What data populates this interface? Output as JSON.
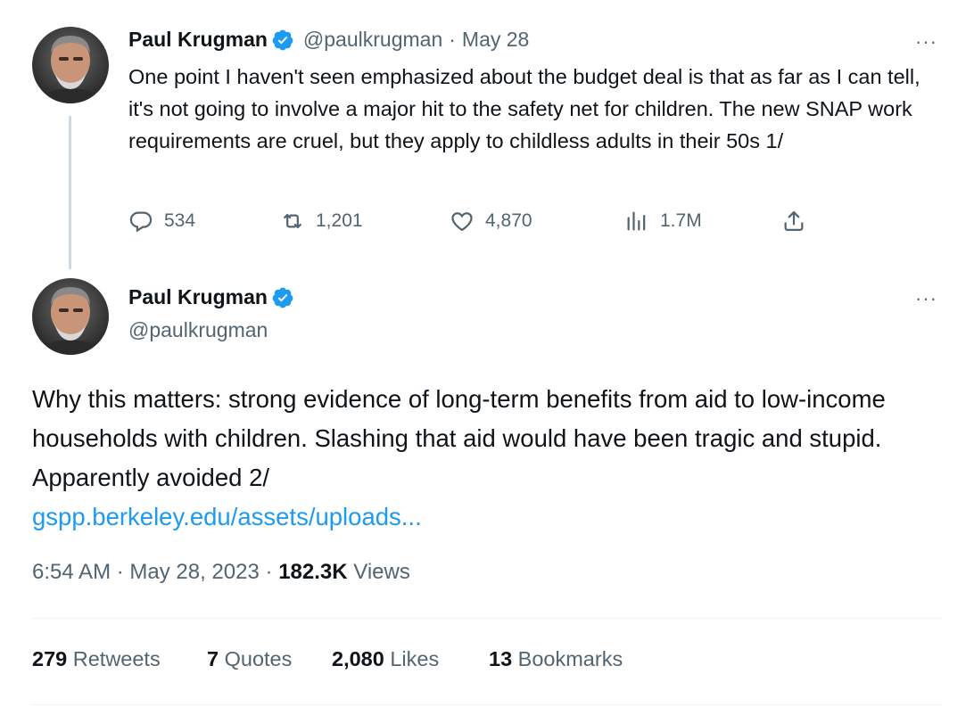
{
  "tweet1": {
    "author_name": "Paul Krugman",
    "handle": "@paulkrugman",
    "separator": "·",
    "date": "May 28",
    "more": "···",
    "text": "One point I haven't seen emphasized about the budget deal is that as far as I can tell, it's not going to involve a major hit to the safety net for children. The new SNAP work requirements are cruel, but they apply to childless adults in their 50s 1/",
    "actions": {
      "replies": "534",
      "retweets": "1,201",
      "likes": "4,870",
      "views": "1.7M"
    },
    "icons": [
      "reply-icon",
      "retweet-icon",
      "like-icon",
      "views-icon",
      "share-icon"
    ]
  },
  "tweet2": {
    "author_name": "Paul Krugman",
    "handle": "@paulkrugman",
    "more": "···",
    "text": "Why this matters: strong evidence of long-term benefits from aid to low-income households with children. Slashing that aid would have been tragic and stupid. Apparently avoided 2/",
    "link": "gspp.berkeley.edu/assets/uploads...",
    "time": "6:54 AM",
    "sep1": "·",
    "date": "May 28, 2023",
    "sep2": "·",
    "views_count": "182.3K",
    "views_label": "Views",
    "stats": {
      "retweets_count": "279",
      "retweets_label": "Retweets",
      "quotes_count": "7",
      "quotes_label": "Quotes",
      "likes_count": "2,080",
      "likes_label": "Likes",
      "bookmarks_count": "13",
      "bookmarks_label": "Bookmarks"
    }
  },
  "colors": {
    "text": "#0f1419",
    "secondary": "#536471",
    "link": "#1d9bf0",
    "verified": "#1d9bf0",
    "thread_line": "#cfd9de",
    "divider": "#eff3f4"
  }
}
